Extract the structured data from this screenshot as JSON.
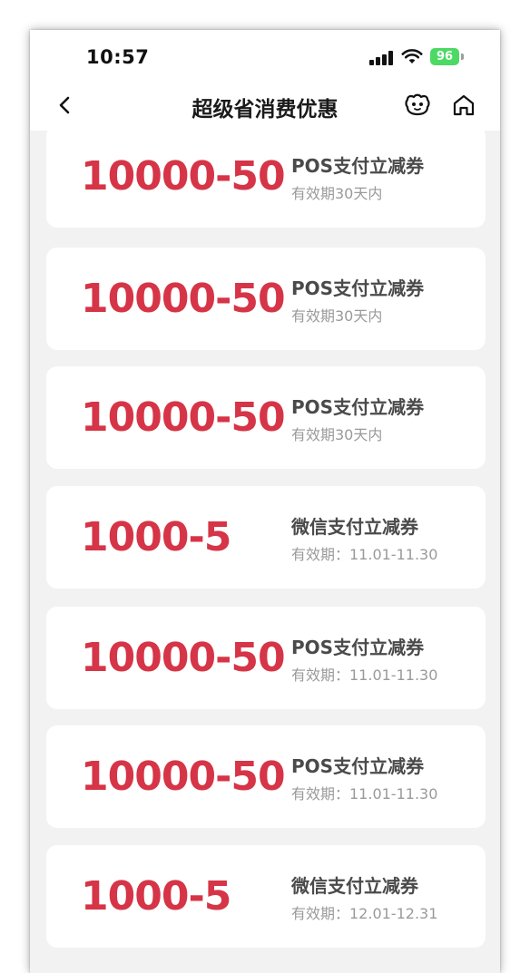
{
  "status_bar": {
    "time": "10:57",
    "battery": "96"
  },
  "nav": {
    "title": "超级省消费优惠",
    "back_icon": "chevron-left-icon",
    "robot_icon": "robot-icon",
    "home_icon": "home-icon"
  },
  "colors": {
    "amount": "#d63447",
    "card_bg": "#ffffff",
    "page_bg": "#f2f2f2",
    "battery": "#4cd964"
  },
  "coupons": [
    {
      "amount": "10000-50",
      "title": "POS支付立减券",
      "validity": "有效期30天内"
    },
    {
      "amount": "10000-50",
      "title": "POS支付立减券",
      "validity": "有效期30天内"
    },
    {
      "amount": "10000-50",
      "title": "POS支付立减券",
      "validity": "有效期30天内"
    },
    {
      "amount": "1000-5",
      "title": "微信支付立减券",
      "validity": "有效期：11.01-11.30"
    },
    {
      "amount": "10000-50",
      "title": "POS支付立减券",
      "validity": "有效期：11.01-11.30"
    },
    {
      "amount": "10000-50",
      "title": "POS支付立减券",
      "validity": "有效期：11.01-11.30"
    },
    {
      "amount": "1000-5",
      "title": "微信支付立减券",
      "validity": "有效期：12.01-12.31"
    }
  ]
}
